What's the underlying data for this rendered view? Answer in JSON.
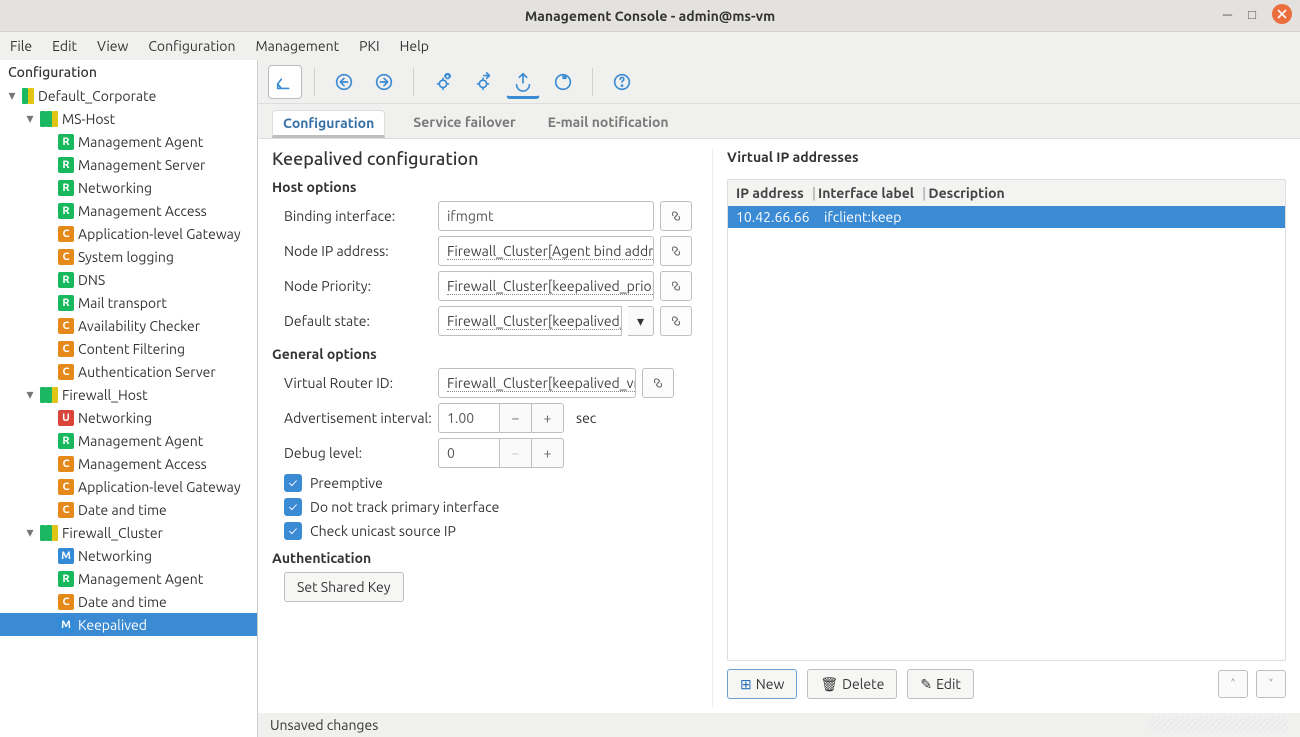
{
  "window": {
    "title": "Management Console - admin@ms-vm"
  },
  "menu": [
    "File",
    "Edit",
    "View",
    "Configuration",
    "Management",
    "PKI",
    "Help"
  ],
  "sidebar": {
    "title": "Configuration",
    "root": {
      "label": "Default_Corporate"
    },
    "hosts": [
      {
        "label": "MS-Host",
        "children": [
          {
            "b": "R",
            "label": "Management Agent"
          },
          {
            "b": "R",
            "label": "Management Server"
          },
          {
            "b": "R",
            "label": "Networking"
          },
          {
            "b": "R",
            "label": "Management Access"
          },
          {
            "b": "C",
            "label": "Application-level Gateway"
          },
          {
            "b": "C",
            "label": "System logging"
          },
          {
            "b": "R",
            "label": "DNS"
          },
          {
            "b": "R",
            "label": "Mail transport"
          },
          {
            "b": "C",
            "label": "Availability Checker"
          },
          {
            "b": "C",
            "label": "Content Filtering"
          },
          {
            "b": "C",
            "label": "Authentication Server"
          }
        ]
      },
      {
        "label": "Firewall_Host",
        "children": [
          {
            "b": "U",
            "label": "Networking"
          },
          {
            "b": "R",
            "label": "Management Agent"
          },
          {
            "b": "C",
            "label": "Management Access"
          },
          {
            "b": "C",
            "label": "Application-level Gateway"
          },
          {
            "b": "C",
            "label": "Date and time"
          }
        ]
      },
      {
        "label": "Firewall_Cluster",
        "children": [
          {
            "b": "M",
            "label": "Networking"
          },
          {
            "b": "R",
            "label": "Management Agent"
          },
          {
            "b": "C",
            "label": "Date and time"
          },
          {
            "b": "M",
            "label": "Keepalived",
            "selected": true
          }
        ]
      }
    ]
  },
  "tabs": [
    "Configuration",
    "Service failover",
    "E-mail notification"
  ],
  "page": {
    "title": "Keepalived configuration",
    "host_options": "Host options",
    "general_options": "General options",
    "authentication": "Authentication",
    "labels": {
      "binding_if": "Binding interface:",
      "node_ip": "Node IP address:",
      "priority": "Node Priority:",
      "default_state": "Default state:",
      "vrid": "Virtual Router ID:",
      "adv_int": "Advertisement interval:",
      "sec": "sec",
      "debug": "Debug level:"
    },
    "values": {
      "binding_if": "ifmgmt",
      "node_ip": "Firewall_Cluster[Agent bind address]",
      "priority": "Firewall_Cluster[keepalived_priority]",
      "default_state": "Firewall_Cluster[keepalived_state]",
      "vrid": "Firewall_Cluster[keepalived_vrid]",
      "adv_int": "1.00",
      "debug": "0"
    },
    "checks": {
      "preemptive": "Preemptive",
      "notrack": "Do not track primary interface",
      "unicast": "Check unicast source IP"
    },
    "set_key": "Set Shared Key"
  },
  "vip": {
    "title": "Virtual IP addresses",
    "cols": [
      "IP address",
      "Interface label",
      "Description"
    ],
    "rows": [
      {
        "ip": "10.42.66.66",
        "if": "ifclient:keep",
        "desc": ""
      }
    ],
    "buttons": {
      "new": "New",
      "delete": "Delete",
      "edit": "Edit"
    }
  },
  "status": "Unsaved changes"
}
